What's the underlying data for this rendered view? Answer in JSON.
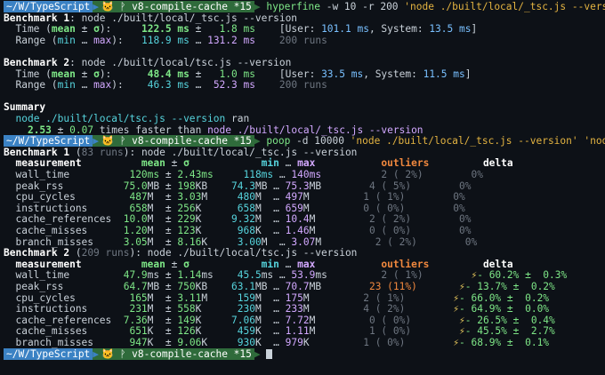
{
  "prompt": {
    "dir": "~/W/TypeScript",
    "git": "🐱 ᚹ v8-compile-cache *15"
  },
  "lines": [
    {
      "prompt": true,
      "segs": [
        [
          "c-cmd",
          "hyperfine"
        ],
        [
          "c-label",
          " -w 10 -r 200 "
        ],
        [
          "c-arg",
          "'node ./built/local/_tsc.js --version'"
        ]
      ]
    },
    {
      "segs": [
        [
          "c-bold",
          "Benchmark 1"
        ],
        [
          "c-label",
          ": node ./built/local/_tsc.js --version"
        ]
      ]
    },
    {
      "segs": [
        [
          "c-label",
          "  Time ("
        ],
        [
          "c-greenb",
          "mean"
        ],
        [
          "c-label",
          " ± "
        ],
        [
          "c-greenb",
          "σ"
        ],
        [
          "c-label",
          "):     "
        ],
        [
          "c-greenb",
          "122.5 ms"
        ],
        [
          "c-label",
          " ±   "
        ],
        [
          "c-green",
          "1.8 ms"
        ],
        [
          "c-label",
          "    [User: "
        ],
        [
          "c-blue",
          "101.1 ms"
        ],
        [
          "c-label",
          ", System: "
        ],
        [
          "c-blue",
          "13.5 ms"
        ],
        [
          "c-label",
          "]"
        ]
      ]
    },
    {
      "segs": [
        [
          "c-label",
          "  Range ("
        ],
        [
          "c-cyan",
          "min"
        ],
        [
          "c-label",
          " … "
        ],
        [
          "c-magenta",
          "max"
        ],
        [
          "c-label",
          "):   "
        ],
        [
          "c-cyan",
          "118.9 ms"
        ],
        [
          "c-label",
          " … "
        ],
        [
          "c-magenta",
          "131.2 ms"
        ],
        [
          "c-label",
          "    "
        ],
        [
          "c-gray",
          "200 runs"
        ]
      ]
    },
    {
      "segs": [
        [
          "c-label",
          ""
        ]
      ]
    },
    {
      "segs": [
        [
          "c-bold",
          "Benchmark 2"
        ],
        [
          "c-label",
          ": node ./built/local/tsc.js --version"
        ]
      ]
    },
    {
      "segs": [
        [
          "c-label",
          "  Time ("
        ],
        [
          "c-greenb",
          "mean"
        ],
        [
          "c-label",
          " ± "
        ],
        [
          "c-greenb",
          "σ"
        ],
        [
          "c-label",
          "):      "
        ],
        [
          "c-greenb",
          "48.4 ms"
        ],
        [
          "c-label",
          " ±   "
        ],
        [
          "c-green",
          "1.0 ms"
        ],
        [
          "c-label",
          "    [User: "
        ],
        [
          "c-blue",
          "33.5 ms"
        ],
        [
          "c-label",
          ", System: "
        ],
        [
          "c-blue",
          "11.5 ms"
        ],
        [
          "c-label",
          "]"
        ]
      ]
    },
    {
      "segs": [
        [
          "c-label",
          "  Range ("
        ],
        [
          "c-cyan",
          "min"
        ],
        [
          "c-label",
          " … "
        ],
        [
          "c-magenta",
          "max"
        ],
        [
          "c-label",
          "):    "
        ],
        [
          "c-cyan",
          "46.3 ms"
        ],
        [
          "c-label",
          " …  "
        ],
        [
          "c-magenta",
          "52.3 ms"
        ],
        [
          "c-label",
          "    "
        ],
        [
          "c-gray",
          "200 runs"
        ]
      ]
    },
    {
      "segs": [
        [
          "c-label",
          ""
        ]
      ]
    },
    {
      "segs": [
        [
          "c-bold",
          "Summary"
        ]
      ]
    },
    {
      "segs": [
        [
          "c-label",
          "  "
        ],
        [
          "c-cyan",
          "node ./built/local/tsc.js --version"
        ],
        [
          "c-label",
          " ran"
        ]
      ]
    },
    {
      "segs": [
        [
          "c-label",
          "    "
        ],
        [
          "c-greenb",
          "2.53"
        ],
        [
          "c-label",
          " ± "
        ],
        [
          "c-green",
          "0.07"
        ],
        [
          "c-label",
          " times faster than "
        ],
        [
          "c-magenta",
          "node ./built/local/_tsc.js --version"
        ]
      ]
    },
    {
      "prompt": true,
      "segs": [
        [
          "c-cmd",
          "poop"
        ],
        [
          "c-label",
          " -d 10000 "
        ],
        [
          "c-arg",
          "'node ./built/local/_tsc.js --version'"
        ],
        [
          "c-label",
          " "
        ],
        [
          "c-arg",
          "'node ./b"
        ]
      ]
    },
    {
      "segs": [
        [
          "c-bold",
          "Benchmark 1"
        ],
        [
          "c-label",
          " ("
        ],
        [
          "c-gray",
          "83 runs"
        ],
        [
          "c-label",
          "): node ./built/local/_tsc.js --version"
        ]
      ]
    },
    {
      "segs": [
        [
          "c-bold",
          "  measurement          "
        ],
        [
          "c-greenb",
          "mean"
        ],
        [
          "c-label",
          " ± "
        ],
        [
          "c-greenb",
          "σ"
        ],
        [
          "c-label",
          "            "
        ],
        [
          "c-cyanb",
          "min"
        ],
        [
          "c-label",
          " … "
        ],
        [
          "c-magentab",
          "max"
        ],
        [
          "c-label",
          "           "
        ],
        [
          "c-orangeb",
          "outliers"
        ],
        [
          "c-label",
          "         "
        ],
        [
          "c-bold",
          "delta"
        ]
      ]
    },
    {
      "segs": [
        [
          "c-label",
          "  wall_time          "
        ],
        [
          "c-green",
          "120ms"
        ],
        [
          "c-label",
          " ± "
        ],
        [
          "c-green",
          "2.43ms"
        ],
        [
          "c-label",
          "     "
        ],
        [
          "c-cyan",
          "118ms"
        ],
        [
          "c-label",
          " … "
        ],
        [
          "c-magenta",
          "140ms"
        ],
        [
          "c-label",
          "          "
        ],
        [
          "c-gray",
          "2 ( 2%)"
        ],
        [
          "c-label",
          "        "
        ],
        [
          "c-gray",
          "0%"
        ]
      ]
    },
    {
      "segs": [
        [
          "c-label",
          "  peak_rss          "
        ],
        [
          "c-green",
          "75.0"
        ],
        [
          "c-label",
          "MB ± "
        ],
        [
          "c-green",
          "198"
        ],
        [
          "c-label",
          "KB    "
        ],
        [
          "c-cyan",
          "74.3"
        ],
        [
          "c-label",
          "MB … "
        ],
        [
          "c-magenta",
          "75.3"
        ],
        [
          "c-label",
          "MB        "
        ],
        [
          "c-gray",
          "4 ( 5%)"
        ],
        [
          "c-label",
          "        "
        ],
        [
          "c-gray",
          "0%"
        ]
      ]
    },
    {
      "segs": [
        [
          "c-label",
          "  cpu_cycles         "
        ],
        [
          "c-green",
          "487"
        ],
        [
          "c-label",
          "M  ± "
        ],
        [
          "c-green",
          "3.03"
        ],
        [
          "c-label",
          "M     "
        ],
        [
          "c-cyan",
          "480"
        ],
        [
          "c-label",
          "M  … "
        ],
        [
          "c-magenta",
          "497"
        ],
        [
          "c-label",
          "M         "
        ],
        [
          "c-gray",
          "1 ( 1%)"
        ],
        [
          "c-label",
          "        "
        ],
        [
          "c-gray",
          "0%"
        ]
      ]
    },
    {
      "segs": [
        [
          "c-label",
          "  instructions       "
        ],
        [
          "c-green",
          "658"
        ],
        [
          "c-label",
          "M  ± "
        ],
        [
          "c-green",
          "256"
        ],
        [
          "c-label",
          "K      "
        ],
        [
          "c-cyan",
          "658"
        ],
        [
          "c-label",
          "M  … "
        ],
        [
          "c-magenta",
          "659"
        ],
        [
          "c-label",
          "M         "
        ],
        [
          "c-gray",
          "0 ( 0%)"
        ],
        [
          "c-label",
          "        "
        ],
        [
          "c-gray",
          "0%"
        ]
      ]
    },
    {
      "segs": [
        [
          "c-label",
          "  cache_references  "
        ],
        [
          "c-green",
          "10.0"
        ],
        [
          "c-label",
          "M  ± "
        ],
        [
          "c-green",
          "229"
        ],
        [
          "c-label",
          "K     "
        ],
        [
          "c-cyan",
          "9.32"
        ],
        [
          "c-label",
          "M  … "
        ],
        [
          "c-magenta",
          "10.4"
        ],
        [
          "c-label",
          "M         "
        ],
        [
          "c-gray",
          "2 ( 2%)"
        ],
        [
          "c-label",
          "        "
        ],
        [
          "c-gray",
          "0%"
        ]
      ]
    },
    {
      "segs": [
        [
          "c-label",
          "  cache_misses      "
        ],
        [
          "c-green",
          "1.20"
        ],
        [
          "c-label",
          "M  ± "
        ],
        [
          "c-green",
          "123"
        ],
        [
          "c-label",
          "K      "
        ],
        [
          "c-cyan",
          "968"
        ],
        [
          "c-label",
          "K  … "
        ],
        [
          "c-magenta",
          "1.46"
        ],
        [
          "c-label",
          "M         "
        ],
        [
          "c-gray",
          "0 ( 0%)"
        ],
        [
          "c-label",
          "        "
        ],
        [
          "c-gray",
          "0%"
        ]
      ]
    },
    {
      "segs": [
        [
          "c-label",
          "  branch_misses     "
        ],
        [
          "c-green",
          "3.05"
        ],
        [
          "c-label",
          "M  ± "
        ],
        [
          "c-green",
          "8.16"
        ],
        [
          "c-label",
          "K     "
        ],
        [
          "c-cyan",
          "3.00"
        ],
        [
          "c-label",
          "M  … "
        ],
        [
          "c-magenta",
          "3.07"
        ],
        [
          "c-label",
          "M         "
        ],
        [
          "c-gray",
          "2 ( 2%)"
        ],
        [
          "c-label",
          "        "
        ],
        [
          "c-gray",
          "0%"
        ]
      ]
    },
    {
      "segs": [
        [
          "c-bold",
          "Benchmark 2"
        ],
        [
          "c-label",
          " ("
        ],
        [
          "c-gray",
          "209 runs"
        ],
        [
          "c-label",
          "): node ./built/local/tsc.js --version"
        ]
      ]
    },
    {
      "segs": [
        [
          "c-bold",
          "  measurement          "
        ],
        [
          "c-greenb",
          "mean"
        ],
        [
          "c-label",
          " ± "
        ],
        [
          "c-greenb",
          "σ"
        ],
        [
          "c-label",
          "            "
        ],
        [
          "c-cyanb",
          "min"
        ],
        [
          "c-label",
          " … "
        ],
        [
          "c-magentab",
          "max"
        ],
        [
          "c-label",
          "           "
        ],
        [
          "c-orangeb",
          "outliers"
        ],
        [
          "c-label",
          "         "
        ],
        [
          "c-bold",
          "delta"
        ]
      ]
    },
    {
      "segs": [
        [
          "c-label",
          "  wall_time         "
        ],
        [
          "c-green",
          "47.9"
        ],
        [
          "c-label",
          "ms ± "
        ],
        [
          "c-green",
          "1.14"
        ],
        [
          "c-label",
          "ms    "
        ],
        [
          "c-cyan",
          "45.5"
        ],
        [
          "c-label",
          "ms … "
        ],
        [
          "c-magenta",
          "53.9"
        ],
        [
          "c-label",
          "ms         "
        ],
        [
          "c-gray",
          "2 ( 1%)"
        ],
        [
          "c-label",
          "        "
        ],
        [
          "c-yellow",
          "⚡"
        ],
        [
          "c-pos",
          "- 60.2% ±  0.3%"
        ]
      ]
    },
    {
      "segs": [
        [
          "c-label",
          "  peak_rss          "
        ],
        [
          "c-green",
          "64.7"
        ],
        [
          "c-label",
          "MB ± "
        ],
        [
          "c-green",
          "750"
        ],
        [
          "c-label",
          "KB    "
        ],
        [
          "c-cyan",
          "63.1"
        ],
        [
          "c-label",
          "MB … "
        ],
        [
          "c-magenta",
          "70.7"
        ],
        [
          "c-label",
          "MB        "
        ],
        [
          "c-orange",
          "23 (11%)"
        ],
        [
          "c-label",
          "       "
        ],
        [
          "c-yellow",
          "⚡"
        ],
        [
          "c-pos",
          "- 13.7% ±  0.2%"
        ]
      ]
    },
    {
      "segs": [
        [
          "c-label",
          "  cpu_cycles         "
        ],
        [
          "c-green",
          "165"
        ],
        [
          "c-label",
          "M  ± "
        ],
        [
          "c-green",
          "3.11"
        ],
        [
          "c-label",
          "M     "
        ],
        [
          "c-cyan",
          "159"
        ],
        [
          "c-label",
          "M  … "
        ],
        [
          "c-magenta",
          "175"
        ],
        [
          "c-label",
          "M         "
        ],
        [
          "c-gray",
          "2 ( 1%)"
        ],
        [
          "c-label",
          "        "
        ],
        [
          "c-yellow",
          "⚡"
        ],
        [
          "c-pos",
          "- 66.0% ±  0.2%"
        ]
      ]
    },
    {
      "segs": [
        [
          "c-label",
          "  instructions       "
        ],
        [
          "c-green",
          "231"
        ],
        [
          "c-label",
          "M  ± "
        ],
        [
          "c-green",
          "558"
        ],
        [
          "c-label",
          "K      "
        ],
        [
          "c-cyan",
          "230"
        ],
        [
          "c-label",
          "M  … "
        ],
        [
          "c-magenta",
          "233"
        ],
        [
          "c-label",
          "M         "
        ],
        [
          "c-gray",
          "4 ( 2%)"
        ],
        [
          "c-label",
          "        "
        ],
        [
          "c-yellow",
          "⚡"
        ],
        [
          "c-pos",
          "- 64.9% ±  0.0%"
        ]
      ]
    },
    {
      "segs": [
        [
          "c-label",
          "  cache_references  "
        ],
        [
          "c-green",
          "7.36"
        ],
        [
          "c-label",
          "M  ± "
        ],
        [
          "c-green",
          "149"
        ],
        [
          "c-label",
          "K     "
        ],
        [
          "c-cyan",
          "7.06"
        ],
        [
          "c-label",
          "M  … "
        ],
        [
          "c-magenta",
          "7.72"
        ],
        [
          "c-label",
          "M         "
        ],
        [
          "c-gray",
          "0 ( 0%)"
        ],
        [
          "c-label",
          "        "
        ],
        [
          "c-yellow",
          "⚡"
        ],
        [
          "c-pos",
          "- 26.5% ±  0.4%"
        ]
      ]
    },
    {
      "segs": [
        [
          "c-label",
          "  cache_misses       "
        ],
        [
          "c-green",
          "651"
        ],
        [
          "c-label",
          "K  ± "
        ],
        [
          "c-green",
          "126"
        ],
        [
          "c-label",
          "K      "
        ],
        [
          "c-cyan",
          "459"
        ],
        [
          "c-label",
          "K  … "
        ],
        [
          "c-magenta",
          "1.11"
        ],
        [
          "c-label",
          "M         "
        ],
        [
          "c-gray",
          "1 ( 0%)"
        ],
        [
          "c-label",
          "        "
        ],
        [
          "c-yellow",
          "⚡"
        ],
        [
          "c-pos",
          "- 45.5% ±  2.7%"
        ]
      ]
    },
    {
      "segs": [
        [
          "c-label",
          "  branch_misses      "
        ],
        [
          "c-green",
          "947"
        ],
        [
          "c-label",
          "K  ± "
        ],
        [
          "c-green",
          "9.06"
        ],
        [
          "c-label",
          "K     "
        ],
        [
          "c-cyan",
          "930"
        ],
        [
          "c-label",
          "K  … "
        ],
        [
          "c-magenta",
          "979"
        ],
        [
          "c-label",
          "K         "
        ],
        [
          "c-gray",
          "1 ( 0%)"
        ],
        [
          "c-label",
          "        "
        ],
        [
          "c-yellow",
          "⚡"
        ],
        [
          "c-pos",
          "- 68.9% ±  0.1%"
        ]
      ]
    },
    {
      "prompt": true,
      "cursor": true,
      "segs": []
    }
  ]
}
